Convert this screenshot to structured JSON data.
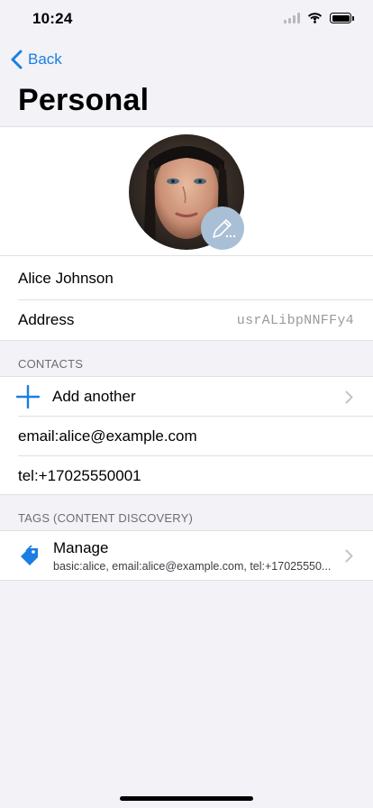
{
  "status_bar": {
    "time": "10:24"
  },
  "nav": {
    "back_label": "Back",
    "title": "Personal"
  },
  "profile": {
    "name": "Alice Johnson",
    "address_label": "Address",
    "address_value": "usrALibpNNFFy4"
  },
  "contacts": {
    "header": "CONTACTS",
    "add_label": "Add another",
    "items": [
      "email:alice@example.com",
      "tel:+17025550001"
    ]
  },
  "tags": {
    "header": "TAGS (CONTENT DISCOVERY)",
    "manage_label": "Manage",
    "summary": "basic:alice, email:alice@example.com, tel:+17025550..."
  },
  "colors": {
    "accent": "#1a7ee3",
    "background": "#f2f2f7",
    "edit_badge": "#a9bfd6"
  },
  "icons": [
    "wifi-icon",
    "battery-icon",
    "back-chevron-icon",
    "pencil-icon",
    "plus-icon",
    "chevron-right-icon",
    "tag-icon"
  ]
}
